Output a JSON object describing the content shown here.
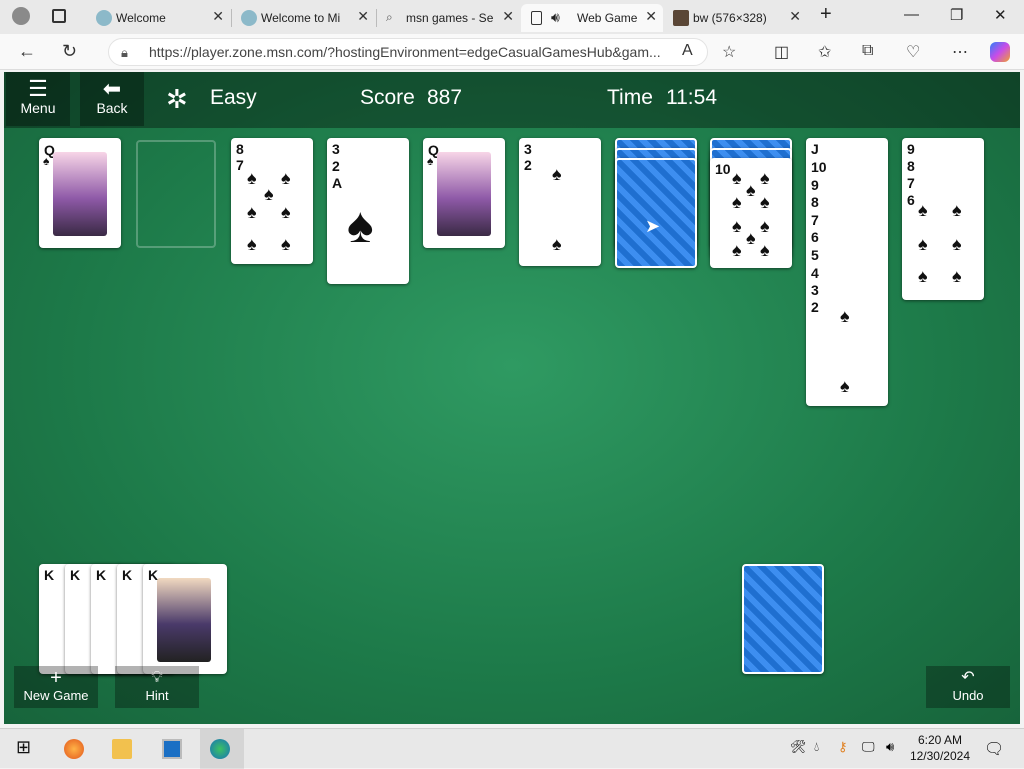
{
  "browser": {
    "tabs": [
      {
        "label": "Welcome",
        "active": false
      },
      {
        "label": "Welcome to Mi",
        "active": false
      },
      {
        "label": "msn games - Se",
        "active": false
      },
      {
        "label": "Web Game",
        "active": true
      },
      {
        "label": "bw (576×328)",
        "active": false
      }
    ],
    "url": "https://player.zone.msn.com/?hostingEnvironment=edgeCasualGamesHub&gam..."
  },
  "game": {
    "menu_label": "Menu",
    "back_label": "Back",
    "difficulty": "Easy",
    "score_label": "Score",
    "score_value": "887",
    "time_label": "Time",
    "time_value": "11:54",
    "new_game_label": "New Game",
    "hint_label": "Hint",
    "undo_label": "Undo",
    "tableau": [
      {
        "cards": [
          "Q"
        ]
      },
      {
        "cards": []
      },
      {
        "cards": [
          "8",
          "7"
        ]
      },
      {
        "cards": [
          "3",
          "2",
          "A"
        ]
      },
      {
        "cards": [
          "Q"
        ]
      },
      {
        "cards": [
          "3",
          "2"
        ]
      },
      {
        "cards": [],
        "facedown": 3
      },
      {
        "cards": [
          "10"
        ],
        "facedown": 2
      },
      {
        "cards": [
          "J",
          "10",
          "9",
          "8",
          "7",
          "6",
          "5",
          "4",
          "3",
          "2"
        ]
      },
      {
        "cards": [
          "9",
          "8",
          "7",
          "6"
        ]
      }
    ],
    "completed_stacks": [
      "K",
      "K",
      "K",
      "K",
      "K"
    ],
    "stock_facedown": true
  },
  "taskbar": {
    "time": "6:20 AM",
    "date": "12/30/2024"
  }
}
